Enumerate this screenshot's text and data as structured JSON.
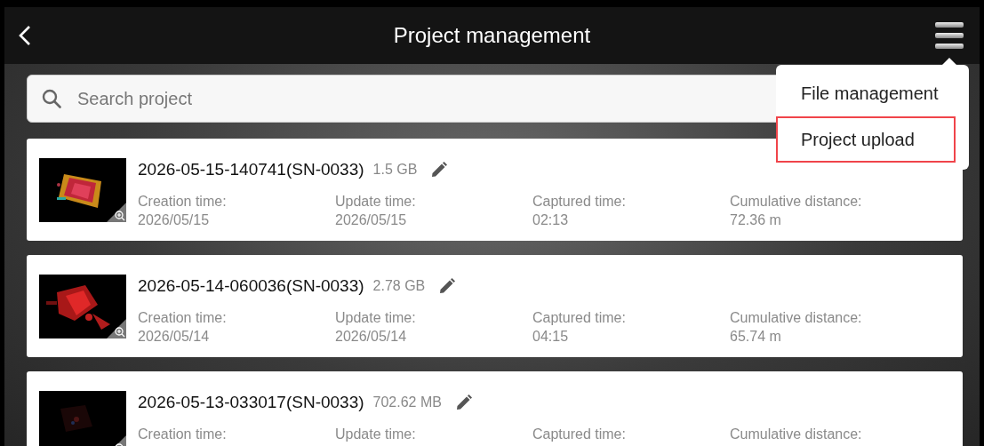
{
  "header": {
    "title": "Project management"
  },
  "search": {
    "placeholder": "Search project"
  },
  "menu": {
    "items": [
      {
        "label": "File management",
        "highlighted": false
      },
      {
        "label": "Project upload",
        "highlighted": true
      }
    ]
  },
  "projects": [
    {
      "name": "2026-05-15-140741(SN-0033)",
      "size": "1.5 GB",
      "fields": [
        {
          "label": "Creation time:",
          "value": "2026/05/15"
        },
        {
          "label": "Update time:",
          "value": "2026/05/15"
        },
        {
          "label": "Captured time:",
          "value": "02:13"
        },
        {
          "label": "Cumulative distance:",
          "value": "72.36 m"
        }
      ]
    },
    {
      "name": "2026-05-14-060036(SN-0033)",
      "size": "2.78 GB",
      "fields": [
        {
          "label": "Creation time:",
          "value": "2026/05/14"
        },
        {
          "label": "Update time:",
          "value": "2026/05/14"
        },
        {
          "label": "Captured time:",
          "value": "04:15"
        },
        {
          "label": "Cumulative distance:",
          "value": "65.74 m"
        }
      ]
    },
    {
      "name": "2026-05-13-033017(SN-0033)",
      "size": "702.62 MB",
      "fields": [
        {
          "label": "Creation time:"
        },
        {
          "label": "Update time:"
        },
        {
          "label": "Captured time:"
        },
        {
          "label": "Cumulative distance:"
        }
      ]
    }
  ]
}
